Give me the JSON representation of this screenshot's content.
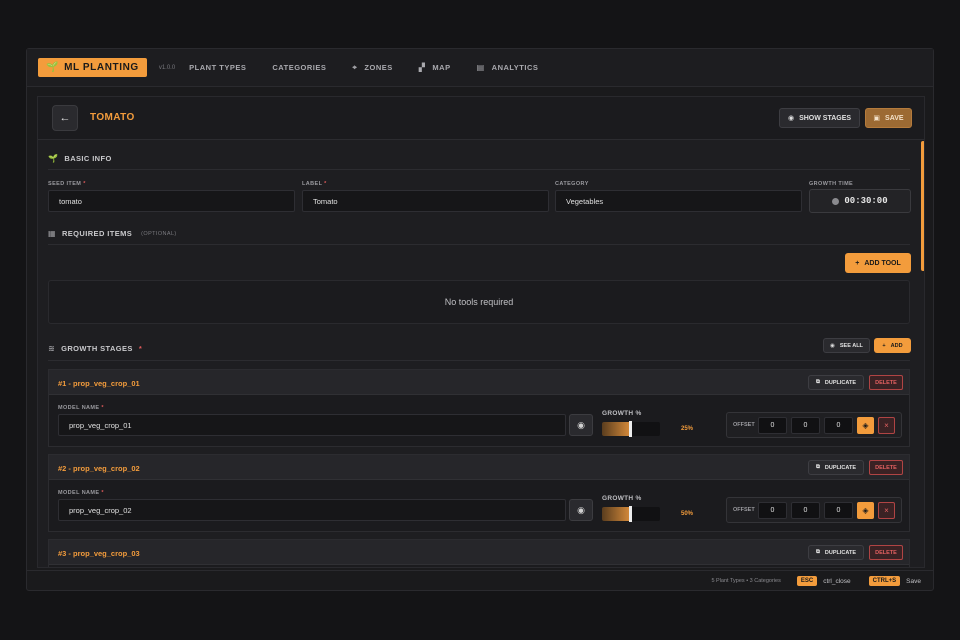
{
  "app": {
    "logo": "ML PLANTING",
    "version": "v1.0.0",
    "nav": [
      {
        "label": "PLANT TYPES",
        "icon": ""
      },
      {
        "label": "CATEGORIES",
        "icon": ""
      },
      {
        "label": "ZONES",
        "icon": "zones-icon"
      },
      {
        "label": "MAP",
        "icon": "map-icon"
      },
      {
        "label": "ANALYTICS",
        "icon": "analytics-icon"
      }
    ]
  },
  "header": {
    "title": "TOMATO",
    "show_stages_label": "SHOW STAGES",
    "save_label": "SAVE"
  },
  "basic_info": {
    "title": "BASIC INFO",
    "seed_item_label": "SEED ITEM",
    "seed_item_value": "tomato",
    "label_label": "LABEL",
    "label_value": "Tomato",
    "category_label": "CATEGORY",
    "category_value": "Vegetables",
    "growth_time_label": "GROWTH TIME",
    "growth_time_value": "00:30:00"
  },
  "required_items": {
    "title": "REQUIRED ITEMS",
    "optional": "(OPTIONAL)",
    "add_tool_label": "ADD TOOL",
    "empty_text": "No tools required"
  },
  "growth_stages": {
    "title": "GROWTH STAGES",
    "see_all_label": "SEE ALL",
    "add_label": "ADD",
    "model_name_label": "MODEL NAME",
    "growth_label": "GROWTH %",
    "offset_label": "OFFSET",
    "duplicate_label": "DUPLICATE",
    "delete_label": "DELETE",
    "stages": [
      {
        "title": "#1 - prop_veg_crop_01",
        "model": "prop_veg_crop_01",
        "growth_pct": 25,
        "growth_text": "25%",
        "offset": [
          "0",
          "0",
          "0"
        ]
      },
      {
        "title": "#2 - prop_veg_crop_02",
        "model": "prop_veg_crop_02",
        "growth_pct": 50,
        "growth_text": "50%",
        "offset": [
          "0",
          "0",
          "0"
        ]
      },
      {
        "title": "#3 - prop_veg_crop_03"
      }
    ]
  },
  "footer": {
    "stats": "5 Plant Types • 3 Categories",
    "esc_key": "ESC",
    "esc_text": "ctrl_close",
    "save_key": "CTRL+S",
    "save_text": "Save"
  },
  "colors": {
    "accent": "#f39c3c",
    "danger": "#e26060",
    "background": "#141416"
  }
}
